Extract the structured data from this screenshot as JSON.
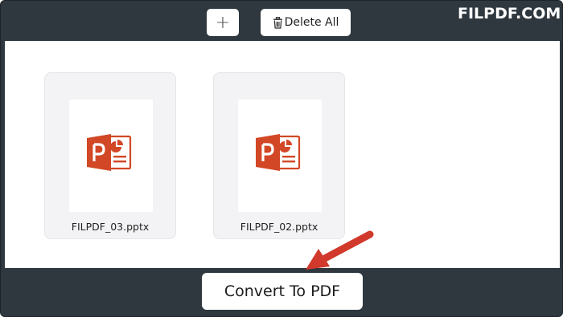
{
  "toolbar": {
    "add_label": "+",
    "delete_all_label": "Delete All"
  },
  "brand": {
    "text": "FILPDF.COM"
  },
  "files": [
    {
      "name": "FILPDF_03.pptx",
      "icon": "powerpoint-icon"
    },
    {
      "name": "FILPDF_02.pptx",
      "icon": "powerpoint-icon"
    }
  ],
  "actions": {
    "convert_label": "Convert To PDF"
  },
  "colors": {
    "frame_bg": "#2f383f",
    "panel_bg": "#ffffff",
    "card_bg": "#f3f3f5",
    "powerpoint_orange": "#d24726",
    "arrow_red": "#d0392b"
  }
}
